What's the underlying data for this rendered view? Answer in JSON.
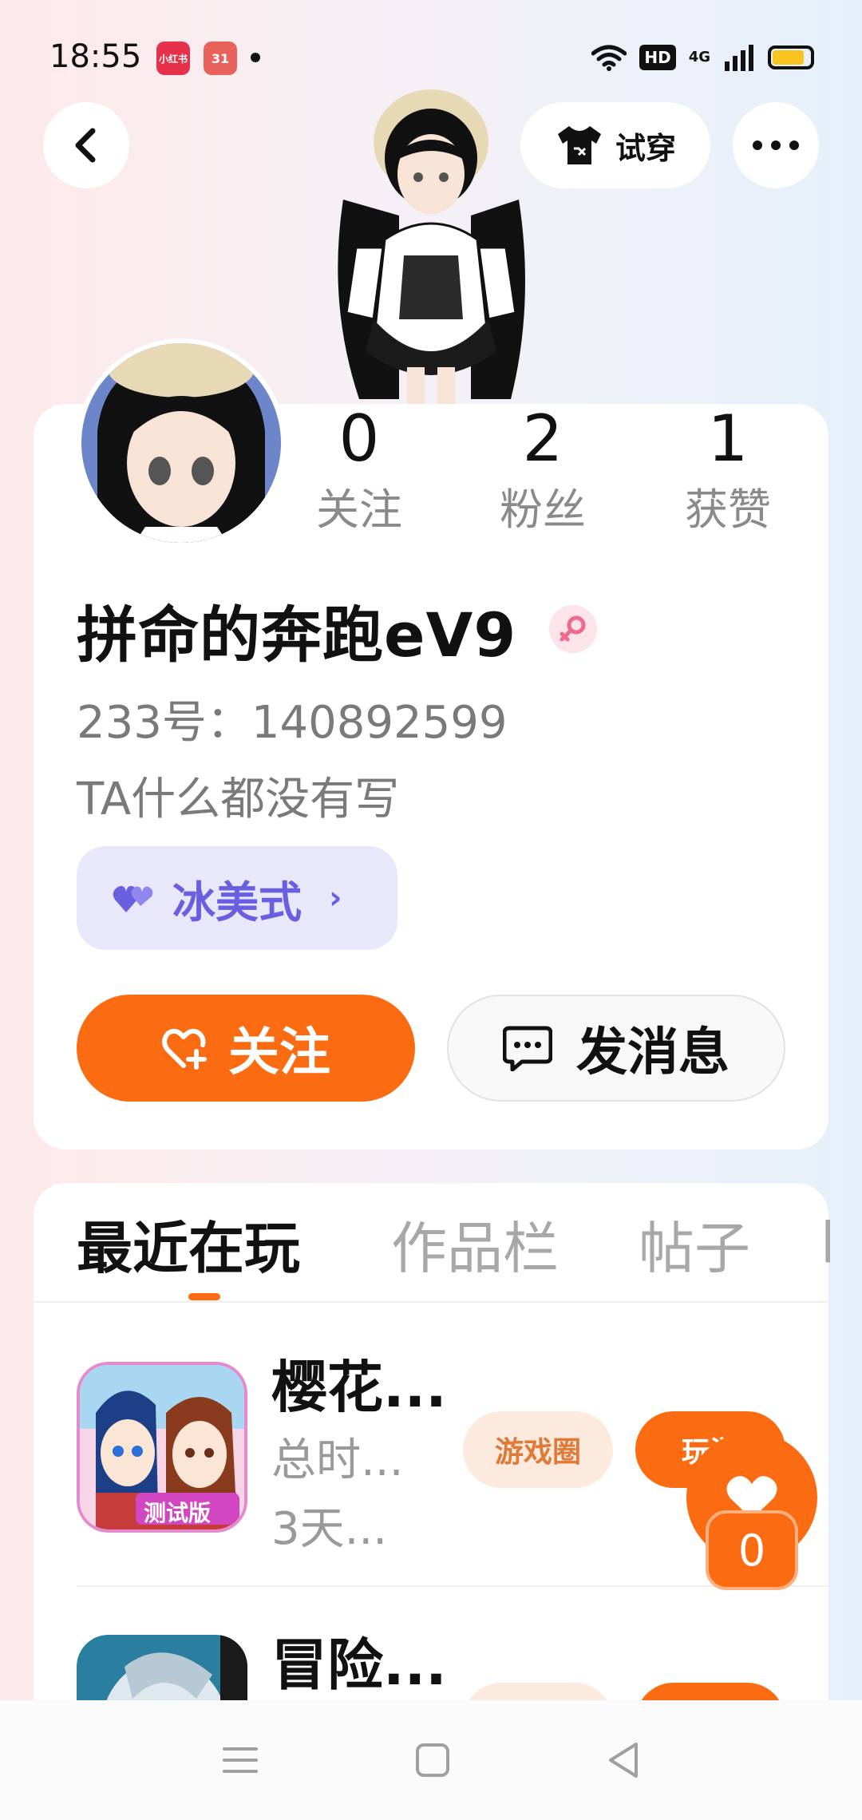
{
  "status_bar": {
    "time": "18:55",
    "app_badges": [
      "小红书",
      "31"
    ],
    "hd_label": "HD",
    "network_label": "4G",
    "battery_level": 0.85
  },
  "header": {
    "try_on_label": "试穿"
  },
  "profile": {
    "stats": [
      {
        "value": "0",
        "label": "关注"
      },
      {
        "value": "2",
        "label": "粉丝"
      },
      {
        "value": "1",
        "label": "获赞"
      }
    ],
    "username": "拼命的奔跑eV9",
    "user_id": "233号：140892599",
    "bio": "TA什么都没有写",
    "style_tag": "冰美式",
    "follow_label": "关注",
    "message_label": "发消息"
  },
  "tabs": [
    {
      "label": "最近在玩",
      "active": true
    },
    {
      "label": "作品栏",
      "active": false
    },
    {
      "label": "帖子",
      "active": false
    }
  ],
  "games": [
    {
      "title": "樱花...",
      "icon_badge": "测试版",
      "total_time": "总时...",
      "last_played": "3天...",
      "circle_label": "游戏圈",
      "play_label": "玩游"
    },
    {
      "title": "冒险..."
    }
  ],
  "float_like": {
    "count": "0"
  },
  "colors": {
    "accent": "#fb6c12",
    "style_tag_text": "#6a5fe0",
    "style_tag_bg": "#e9e8fb"
  }
}
